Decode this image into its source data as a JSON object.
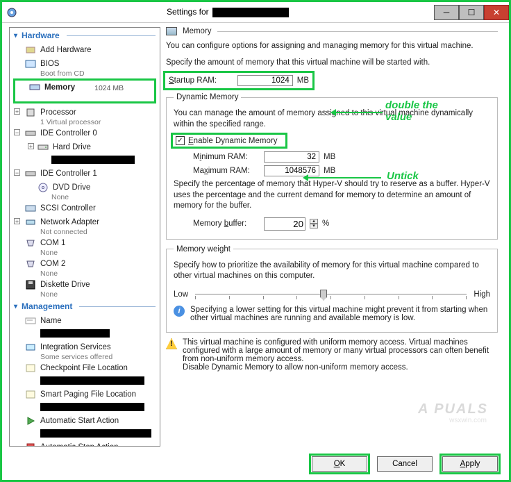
{
  "window": {
    "title_prefix": "Settings for"
  },
  "tree": {
    "hardware_label": "Hardware",
    "management_label": "Management",
    "add_hardware": "Add Hardware",
    "bios": "BIOS",
    "bios_sub": "Boot from CD",
    "memory": "Memory",
    "memory_sub": "1024 MB",
    "processor": "Processor",
    "processor_sub": "1 Virtual processor",
    "ide0": "IDE Controller 0",
    "hard_drive": "Hard Drive",
    "ide1": "IDE Controller 1",
    "dvd": "DVD Drive",
    "dvd_sub": "None",
    "scsi": "SCSI Controller",
    "net": "Network Adapter",
    "net_sub": "Not connected",
    "com1": "COM 1",
    "com1_sub": "None",
    "com2": "COM 2",
    "com2_sub": "None",
    "diskette": "Diskette Drive",
    "diskette_sub": "None",
    "mgmt_name": "Name",
    "mgmt_integ": "Integration Services",
    "mgmt_integ_sub": "Some services offered",
    "mgmt_checkpoint": "Checkpoint File Location",
    "mgmt_smart": "Smart Paging File Location",
    "mgmt_autostart": "Automatic Start Action",
    "mgmt_autostop": "Automatic Stop Action"
  },
  "main": {
    "header": "Memory",
    "intro": "You can configure options for assigning and managing memory for this virtual machine.",
    "specify_startup": "Specify the amount of memory that this virtual machine will be started with.",
    "startup_label": "Startup RAM:",
    "startup_value": "1024",
    "mb": "MB",
    "dyn_legend": "Dynamic Memory",
    "dyn_intro": "You can manage the amount of memory assigned to this virtual machine dynamically within the specified range.",
    "enable_dyn": "Enable Dynamic Memory",
    "min_label": "Minimum RAM:",
    "min_value": "32",
    "max_label": "Maximum RAM:",
    "max_value": "1048576",
    "buffer_intro": "Specify the percentage of memory that Hyper-V should try to reserve as a buffer. Hyper-V uses the percentage and the current demand for memory to determine an amount of memory for the buffer.",
    "buffer_label": "Memory buffer:",
    "buffer_value": "20",
    "percent": "%",
    "weight_legend": "Memory weight",
    "weight_intro": "Specify how to prioritize the availability of memory for this virtual machine compared to other virtual machines on this computer.",
    "low": "Low",
    "high": "High",
    "info_text": "Specifying a lower setting for this virtual machine might prevent it from starting when other virtual machines are running and available memory is low.",
    "warn_text": "This virtual machine is configured with uniform memory access. Virtual machines configured with a large amount of memory or many virtual processors can often benefit from non-uniform memory access.\nDisable Dynamic Memory to allow non-uniform memory access."
  },
  "buttons": {
    "ok": "OK",
    "cancel": "Cancel",
    "apply": "Apply"
  },
  "annotations": {
    "double": "double the value",
    "untick": "Untick"
  },
  "watermark": {
    "brand": "A PUALS",
    "site": "wsxwin.com"
  }
}
